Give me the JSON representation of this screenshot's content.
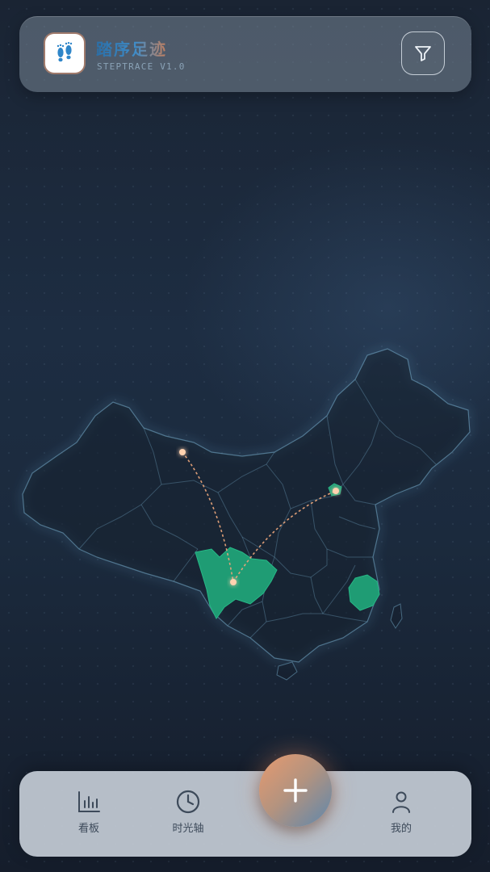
{
  "header": {
    "app_name": "踏序足迹",
    "app_subtitle": "STEPTRACE V1.0",
    "logo_icon": "footprints-icon",
    "filter_icon": "filter-icon"
  },
  "map": {
    "region": "China provinces",
    "highlight_color": "#1f9c74",
    "route_color": "#e8a37a",
    "visited_regions": [
      "Sichuan",
      "Beijing",
      "Fujian"
    ],
    "route_points": [
      "Xinjiang",
      "Sichuan",
      "Beijing"
    ]
  },
  "nav": {
    "items": [
      {
        "label": "看板",
        "icon": "bar-chart-icon"
      },
      {
        "label": "时光轴",
        "icon": "clock-icon"
      },
      {
        "label": "我的",
        "icon": "user-icon"
      }
    ],
    "add_icon": "plus-icon",
    "fab_colors": [
      "#e79a6f",
      "#5d87ad"
    ]
  }
}
